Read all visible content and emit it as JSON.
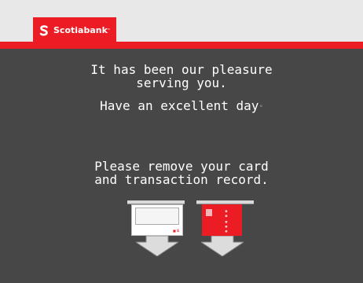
{
  "brand": {
    "name": "Scotiabank",
    "trademark": "™",
    "primary_color": "#ec1c24"
  },
  "colors": {
    "background": "#474747",
    "header": "#e8e8e8",
    "text": "#ffffff"
  },
  "messages": {
    "thanks_line1": "It has been our pleasure",
    "thanks_line2": "serving you.",
    "greeting": "Have an excellent day",
    "greeting_dot": "°",
    "instruction_line1": "Please remove your card",
    "instruction_line2": "and transaction record."
  },
  "icons": {
    "logo": "scotiabank-s-icon",
    "receipt": "transaction-record-icon",
    "card": "bank-card-icon",
    "arrow": "arrow-down-icon"
  }
}
